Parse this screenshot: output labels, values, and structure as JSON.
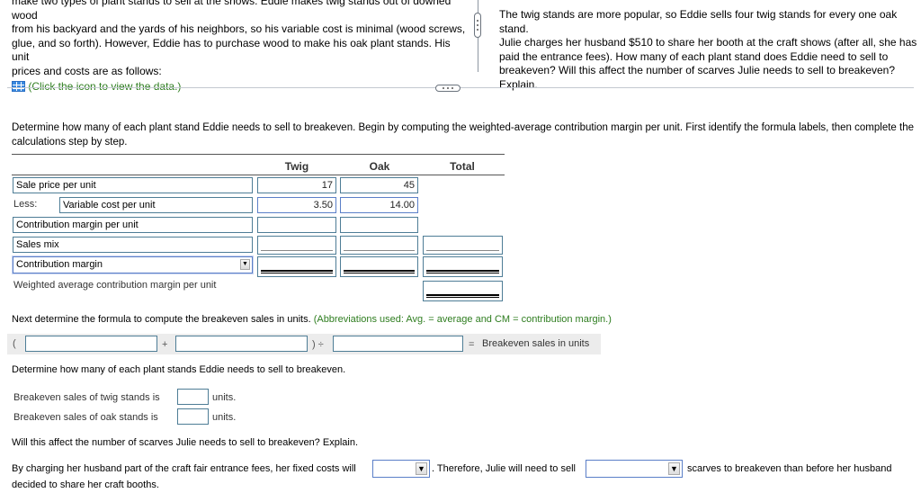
{
  "problem": {
    "left_text_lines": [
      "make two types of plant stands to sell at the shows. Eddie makes twig stands out of downed wood",
      "from his backyard and the yards of his neighbors, so his variable cost is minimal (wood screws,",
      "glue, and so forth). However, Eddie has to purchase wood to make his oak plant stands. His unit",
      "prices and costs are as follows:"
    ],
    "data_link": "(Click the icon to view the data.)",
    "right_text_lines": [
      "The twig stands are more popular, so Eddie sells four twig stands for every one oak stand.",
      "Julie charges her husband $510 to share her booth at the craft shows (after all, she has",
      "paid the entrance fees). How many of each plant stand does Eddie need to sell to",
      "breakeven? Will this affect the number of scarves Julie needs to sell to breakeven?",
      "Explain."
    ]
  },
  "instructions": {
    "line1": "Determine how many of each plant stand Eddie needs to sell to breakeven. Begin by computing the weighted-average contribution margin per unit. First identify the formula labels, then complete the",
    "line2": "calculations step by step."
  },
  "cm_table": {
    "headers": [
      "Twig",
      "Oak",
      "Total"
    ],
    "rows": [
      {
        "label": "Sale price per unit",
        "twig": "17",
        "oak": "45",
        "total": ""
      },
      {
        "prefix": "Less:",
        "label": "Variable cost per unit",
        "twig": "3.50",
        "oak": "14.00",
        "total": ""
      },
      {
        "label": "Contribution margin per unit",
        "twig": "",
        "oak": "",
        "total": ""
      },
      {
        "label": "Sales mix",
        "twig": "",
        "oak": "",
        "total": ""
      },
      {
        "label": "Contribution margin",
        "twig": "",
        "oak": "",
        "total": ""
      },
      {
        "label": "Weighted average contribution margin per unit",
        "total": ""
      }
    ]
  },
  "formula": {
    "intro": "Next determine the formula to compute the breakeven sales in units.",
    "note": "(Abbreviations used: Avg. = average and CM = contribution margin.)",
    "open_paren": "(",
    "plus": "+",
    "close_div": ") ÷",
    "equals": "=",
    "result_label": "Breakeven sales in units",
    "input1": "",
    "input2": "",
    "input3": ""
  },
  "breakeven": {
    "intro": "Determine how many of each plant stands Eddie needs to sell to breakeven.",
    "twig_label": "Breakeven sales of twig stands is",
    "twig_value": "",
    "oak_label": "Breakeven sales of oak stands is",
    "oak_value": "",
    "units": "units."
  },
  "explain": {
    "question": "Will this affect the number of scarves Julie needs to sell to breakeven? Explain.",
    "part1": "By charging her husband part of the craft fair entrance fees, her fixed costs will",
    "select1": "",
    "part2": ". Therefore, Julie will need to sell",
    "select2": "",
    "part3": "scarves to breakeven than before her husband",
    "part4": "decided to share her craft booths."
  },
  "icons": {
    "dropdown": "▼"
  }
}
